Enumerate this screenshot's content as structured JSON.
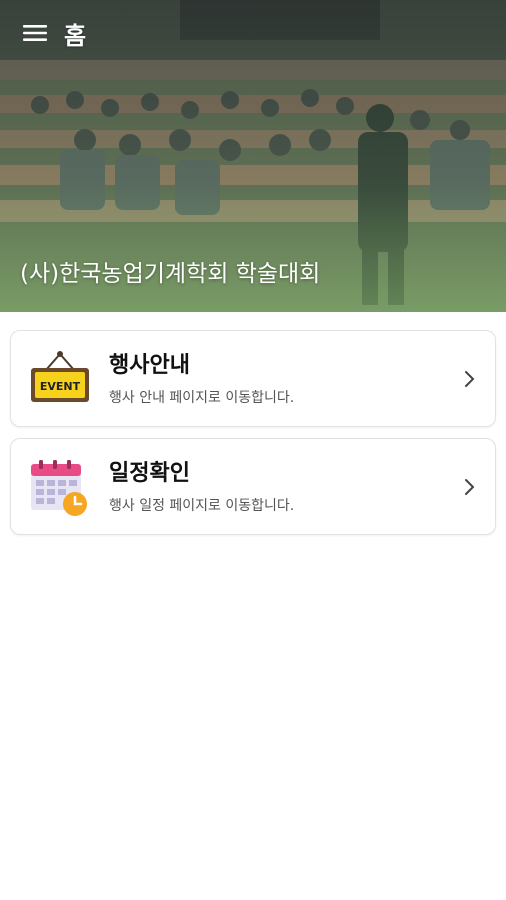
{
  "app_bar": {
    "title": "홈",
    "menu_icon": "hamburger-menu-icon"
  },
  "hero": {
    "caption": "(사)한국농업기계학회 학술대회",
    "image": "conference-audience-photo"
  },
  "cards": [
    {
      "title": "행사안내",
      "subtitle": "행사 안내 페이지로 이동합니다.",
      "icon": "event-sign-icon",
      "icon_text": "EVENT"
    },
    {
      "title": "일정확인",
      "subtitle": "행사 일정 페이지로 이동합니다.",
      "icon": "calendar-clock-icon"
    }
  ],
  "colors": {
    "hero_green": "#9ccc80",
    "event_sign_yellow": "#f7d21c",
    "calendar_pink": "#e94b86",
    "clock_orange": "#f5a623"
  }
}
